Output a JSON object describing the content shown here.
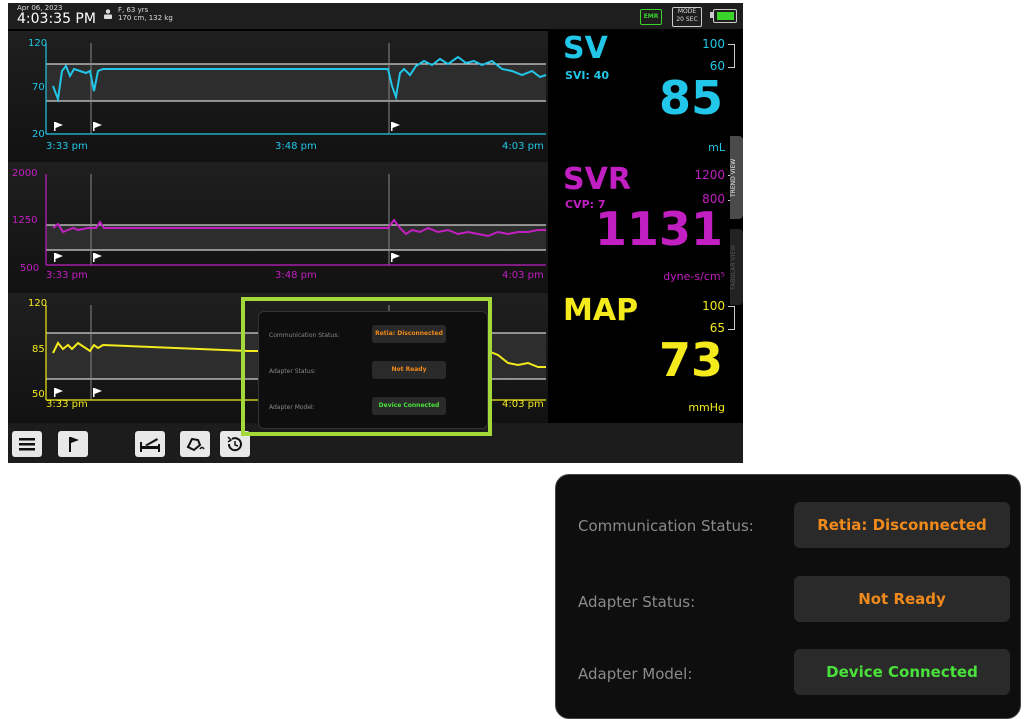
{
  "header": {
    "date": "Apr 06, 2023",
    "time": "4:03:35 PM",
    "patient_line1": "F, 63 yrs",
    "patient_line2": "170 cm, 132 kg",
    "emr_label": "EMR",
    "mode_label": "MODE",
    "mode_value": "20 SEC",
    "battery_level": 1.0
  },
  "trends": {
    "sv": {
      "y_max": "120",
      "y_mid": "70",
      "y_min": "20",
      "color": "#21c6e8"
    },
    "svr": {
      "y_max": "2000",
      "y_mid": "1250",
      "y_min": "500",
      "color": "#c21fc2"
    },
    "map": {
      "y_max": "120",
      "y_mid": "85",
      "y_min": "50",
      "color": "#f4ea1c"
    },
    "times": [
      "3:33 pm",
      "3:48 pm",
      "4:03 pm"
    ]
  },
  "params": {
    "sv": {
      "name": "SV",
      "sub": "SVI: 40",
      "lim_high": "100",
      "lim_low": "60",
      "value": "85",
      "unit": "mL"
    },
    "svr": {
      "name": "SVR",
      "sub": "CVP: 7",
      "lim_high": "1200",
      "lim_low": "800",
      "value": "1131",
      "unit": "dyne-s/cm⁵"
    },
    "map": {
      "name": "MAP",
      "lim_high": "100",
      "lim_low": "65",
      "value": "73",
      "unit": "mmHg"
    }
  },
  "side_tabs": {
    "trend": "TREND VIEW",
    "tabular": "TABULAR VIEW"
  },
  "dialog": {
    "rows": [
      {
        "label": "Communication Status:",
        "value": "Retia: Disconnected",
        "color": "#f08a1a"
      },
      {
        "label": "Adapter Status:",
        "value": "Not Ready",
        "color": "#f08a1a"
      },
      {
        "label": "Adapter Model:",
        "value": "Device Connected",
        "color": "#49e23a"
      }
    ]
  },
  "colors": {
    "highlight": "#a5d83a",
    "background": "#000000"
  }
}
